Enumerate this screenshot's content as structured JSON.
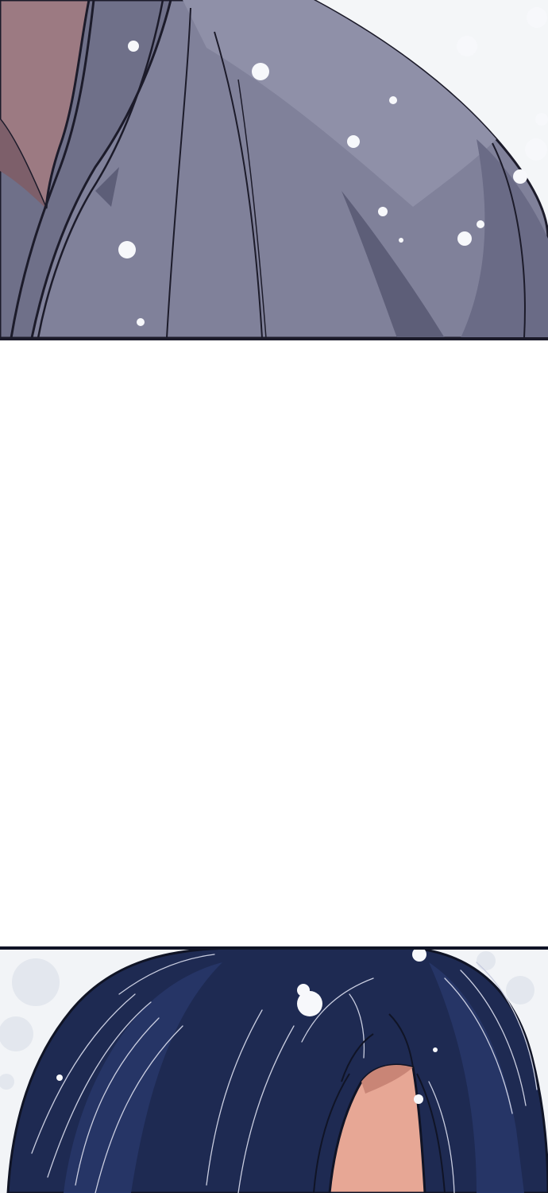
{
  "page": {
    "background": "#ffffff"
  },
  "panels": [
    {
      "id": "top",
      "subject": "shoulder-and-robe",
      "colors": {
        "snow_sky": "#f4f6f8",
        "robe_light": "#8e8ea6",
        "robe_mid": "#777890",
        "robe_dark": "#5d5e78",
        "robe_shadow": "#4a4b66",
        "skin": "#9c7a82",
        "skin_shadow": "#7d5f6a",
        "ink": "#1c1b2a",
        "snowflake": "#f7f8fb"
      }
    },
    {
      "id": "bottom",
      "subject": "hair-and-forehead",
      "colors": {
        "snow_sky": "#f2f4f7",
        "hair_dark": "#1b2547",
        "hair_mid": "#263566",
        "hair_highlight": "#c9cde0",
        "skin": "#e7a795",
        "skin_shadow": "#c98576",
        "ink": "#101426",
        "snowflake": "#f7f8fb"
      }
    }
  ]
}
